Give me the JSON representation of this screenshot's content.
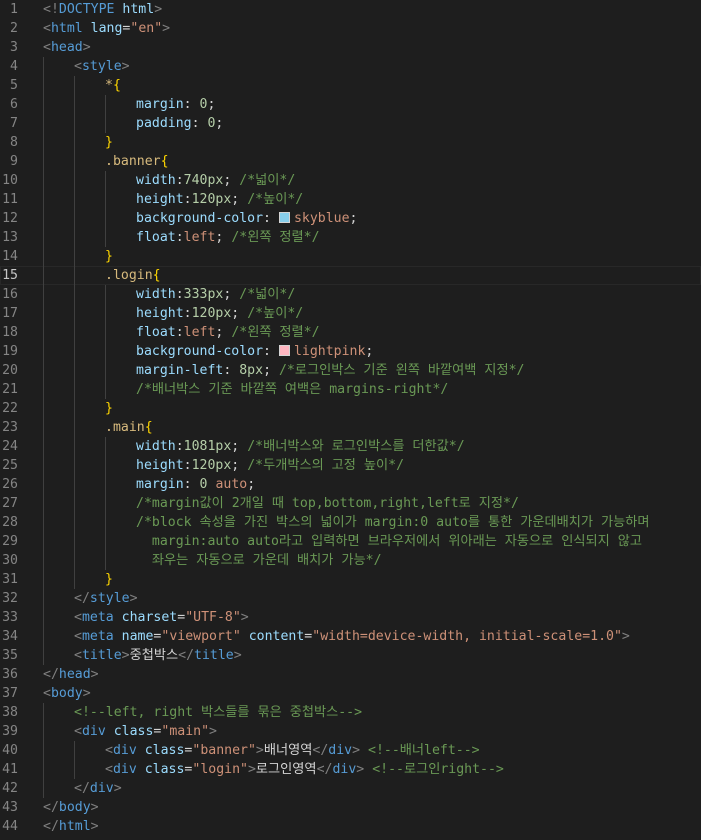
{
  "editor": {
    "current_line": 15,
    "lines": [
      {
        "n": "1",
        "indent": 0,
        "tokens": [
          {
            "t": "<!",
            "c": "punct"
          },
          {
            "t": "DOCTYPE ",
            "c": "tag"
          },
          {
            "t": "html",
            "c": "attr"
          },
          {
            "t": ">",
            "c": "punct"
          }
        ]
      },
      {
        "n": "2",
        "indent": 0,
        "tokens": [
          {
            "t": "<",
            "c": "punct"
          },
          {
            "t": "html ",
            "c": "tag"
          },
          {
            "t": "lang",
            "c": "attr"
          },
          {
            "t": "=",
            "c": "default"
          },
          {
            "t": "\"en\"",
            "c": "string"
          },
          {
            "t": ">",
            "c": "punct"
          }
        ]
      },
      {
        "n": "3",
        "indent": 0,
        "tokens": [
          {
            "t": "<",
            "c": "punct"
          },
          {
            "t": "head",
            "c": "tag"
          },
          {
            "t": ">",
            "c": "punct"
          }
        ]
      },
      {
        "n": "4",
        "indent": 1,
        "tokens": [
          {
            "t": "<",
            "c": "punct"
          },
          {
            "t": "style",
            "c": "tag"
          },
          {
            "t": ">",
            "c": "punct"
          }
        ]
      },
      {
        "n": "5",
        "indent": 2,
        "tokens": [
          {
            "t": "*",
            "c": "sel"
          },
          {
            "t": "{",
            "c": "brace"
          }
        ]
      },
      {
        "n": "6",
        "indent": 3,
        "tokens": [
          {
            "t": "margin",
            "c": "prop"
          },
          {
            "t": ": ",
            "c": "default"
          },
          {
            "t": "0",
            "c": "num"
          },
          {
            "t": ";",
            "c": "default"
          }
        ]
      },
      {
        "n": "7",
        "indent": 3,
        "tokens": [
          {
            "t": "padding",
            "c": "prop"
          },
          {
            "t": ": ",
            "c": "default"
          },
          {
            "t": "0",
            "c": "num"
          },
          {
            "t": ";",
            "c": "default"
          }
        ]
      },
      {
        "n": "8",
        "indent": 2,
        "tokens": [
          {
            "t": "}",
            "c": "brace"
          }
        ]
      },
      {
        "n": "9",
        "indent": 2,
        "tokens": [
          {
            "t": ".banner",
            "c": "sel"
          },
          {
            "t": "{",
            "c": "brace"
          }
        ]
      },
      {
        "n": "10",
        "indent": 3,
        "tokens": [
          {
            "t": "width",
            "c": "prop"
          },
          {
            "t": ":",
            "c": "default"
          },
          {
            "t": "740px",
            "c": "num"
          },
          {
            "t": "; ",
            "c": "default"
          },
          {
            "t": "/*넓이*/",
            "c": "comment"
          }
        ]
      },
      {
        "n": "11",
        "indent": 3,
        "tokens": [
          {
            "t": "height",
            "c": "prop"
          },
          {
            "t": ":",
            "c": "default"
          },
          {
            "t": "120px",
            "c": "num"
          },
          {
            "t": "; ",
            "c": "default"
          },
          {
            "t": "/*높이*/",
            "c": "comment"
          }
        ]
      },
      {
        "n": "12",
        "indent": 3,
        "tokens": [
          {
            "t": "background-color",
            "c": "prop"
          },
          {
            "t": ": ",
            "c": "default"
          },
          {
            "t": "",
            "c": "swatch",
            "color": "#87ceeb"
          },
          {
            "t": "skyblue",
            "c": "val"
          },
          {
            "t": ";",
            "c": "default"
          }
        ]
      },
      {
        "n": "13",
        "indent": 3,
        "tokens": [
          {
            "t": "float",
            "c": "prop"
          },
          {
            "t": ":",
            "c": "default"
          },
          {
            "t": "left",
            "c": "val"
          },
          {
            "t": "; ",
            "c": "default"
          },
          {
            "t": "/*왼쪽 정렬*/",
            "c": "comment"
          }
        ]
      },
      {
        "n": "14",
        "indent": 2,
        "tokens": [
          {
            "t": "}",
            "c": "brace"
          }
        ]
      },
      {
        "n": "15",
        "indent": 2,
        "tokens": [
          {
            "t": ".login",
            "c": "sel"
          },
          {
            "t": "{",
            "c": "brace"
          }
        ]
      },
      {
        "n": "16",
        "indent": 3,
        "tokens": [
          {
            "t": "width",
            "c": "prop"
          },
          {
            "t": ":",
            "c": "default"
          },
          {
            "t": "333px",
            "c": "num"
          },
          {
            "t": "; ",
            "c": "default"
          },
          {
            "t": "/*넓이*/",
            "c": "comment"
          }
        ]
      },
      {
        "n": "17",
        "indent": 3,
        "tokens": [
          {
            "t": "height",
            "c": "prop"
          },
          {
            "t": ":",
            "c": "default"
          },
          {
            "t": "120px",
            "c": "num"
          },
          {
            "t": "; ",
            "c": "default"
          },
          {
            "t": "/*높이*/",
            "c": "comment"
          }
        ]
      },
      {
        "n": "18",
        "indent": 3,
        "tokens": [
          {
            "t": "float",
            "c": "prop"
          },
          {
            "t": ":",
            "c": "default"
          },
          {
            "t": "left",
            "c": "val"
          },
          {
            "t": "; ",
            "c": "default"
          },
          {
            "t": "/*왼쪽 정렬*/",
            "c": "comment"
          }
        ]
      },
      {
        "n": "19",
        "indent": 3,
        "tokens": [
          {
            "t": "background-color",
            "c": "prop"
          },
          {
            "t": ": ",
            "c": "default"
          },
          {
            "t": "",
            "c": "swatch",
            "color": "#ffb6c1"
          },
          {
            "t": "lightpink",
            "c": "val"
          },
          {
            "t": ";",
            "c": "default"
          }
        ]
      },
      {
        "n": "20",
        "indent": 3,
        "tokens": [
          {
            "t": "margin-left",
            "c": "prop"
          },
          {
            "t": ": ",
            "c": "default"
          },
          {
            "t": "8px",
            "c": "num"
          },
          {
            "t": "; ",
            "c": "default"
          },
          {
            "t": "/*로그인박스 기준 왼쪽 바깥여백 지정*/",
            "c": "comment"
          }
        ]
      },
      {
        "n": "21",
        "indent": 3,
        "tokens": [
          {
            "t": "/*배너박스 기준 바깥쪽 여백은 margins-right*/",
            "c": "comment"
          }
        ]
      },
      {
        "n": "22",
        "indent": 2,
        "tokens": [
          {
            "t": "}",
            "c": "brace"
          }
        ]
      },
      {
        "n": "23",
        "indent": 2,
        "tokens": [
          {
            "t": ".main",
            "c": "sel"
          },
          {
            "t": "{",
            "c": "brace"
          }
        ]
      },
      {
        "n": "24",
        "indent": 3,
        "tokens": [
          {
            "t": "width",
            "c": "prop"
          },
          {
            "t": ":",
            "c": "default"
          },
          {
            "t": "1081px",
            "c": "num"
          },
          {
            "t": "; ",
            "c": "default"
          },
          {
            "t": "/*배너박스와 로그인박스를 더한값*/",
            "c": "comment"
          }
        ]
      },
      {
        "n": "25",
        "indent": 3,
        "tokens": [
          {
            "t": "height",
            "c": "prop"
          },
          {
            "t": ":",
            "c": "default"
          },
          {
            "t": "120px",
            "c": "num"
          },
          {
            "t": "; ",
            "c": "default"
          },
          {
            "t": "/*두개박스의 고정 높이*/",
            "c": "comment"
          }
        ]
      },
      {
        "n": "26",
        "indent": 3,
        "tokens": [
          {
            "t": "margin",
            "c": "prop"
          },
          {
            "t": ": ",
            "c": "default"
          },
          {
            "t": "0",
            "c": "num"
          },
          {
            "t": " ",
            "c": "default"
          },
          {
            "t": "auto",
            "c": "val"
          },
          {
            "t": ";",
            "c": "default"
          }
        ]
      },
      {
        "n": "27",
        "indent": 3,
        "tokens": [
          {
            "t": "/*margin값이 2개일 때 top,bottom,right,left로 지정*/",
            "c": "comment"
          }
        ]
      },
      {
        "n": "28",
        "indent": 3,
        "tokens": [
          {
            "t": "/*block 속성을 가진 박스의 넓이가 margin:0 auto를 통한 가운데배치가 가능하며",
            "c": "comment"
          }
        ]
      },
      {
        "n": "29",
        "indent": 3,
        "tokens": [
          {
            "t": "  margin:auto auto라고 입력하면 브라우저에서 위아래는 자동으로 인식되지 않고",
            "c": "comment"
          }
        ]
      },
      {
        "n": "30",
        "indent": 3,
        "tokens": [
          {
            "t": "  좌우는 자동으로 가운데 배치가 가능*/",
            "c": "comment"
          }
        ]
      },
      {
        "n": "31",
        "indent": 2,
        "tokens": [
          {
            "t": "}",
            "c": "brace"
          }
        ]
      },
      {
        "n": "32",
        "indent": 1,
        "tokens": [
          {
            "t": "</",
            "c": "punct"
          },
          {
            "t": "style",
            "c": "tag"
          },
          {
            "t": ">",
            "c": "punct"
          }
        ]
      },
      {
        "n": "33",
        "indent": 1,
        "tokens": [
          {
            "t": "<",
            "c": "punct"
          },
          {
            "t": "meta ",
            "c": "tag"
          },
          {
            "t": "charset",
            "c": "attr"
          },
          {
            "t": "=",
            "c": "default"
          },
          {
            "t": "\"UTF-8\"",
            "c": "string"
          },
          {
            "t": ">",
            "c": "punct"
          }
        ]
      },
      {
        "n": "34",
        "indent": 1,
        "tokens": [
          {
            "t": "<",
            "c": "punct"
          },
          {
            "t": "meta ",
            "c": "tag"
          },
          {
            "t": "name",
            "c": "attr"
          },
          {
            "t": "=",
            "c": "default"
          },
          {
            "t": "\"viewport\" ",
            "c": "string"
          },
          {
            "t": "content",
            "c": "attr"
          },
          {
            "t": "=",
            "c": "default"
          },
          {
            "t": "\"width=device-width, initial-scale=1.0\"",
            "c": "string"
          },
          {
            "t": ">",
            "c": "punct"
          }
        ]
      },
      {
        "n": "35",
        "indent": 1,
        "tokens": [
          {
            "t": "<",
            "c": "punct"
          },
          {
            "t": "title",
            "c": "tag"
          },
          {
            "t": ">",
            "c": "punct"
          },
          {
            "t": "중첩박스",
            "c": "default"
          },
          {
            "t": "</",
            "c": "punct"
          },
          {
            "t": "title",
            "c": "tag"
          },
          {
            "t": ">",
            "c": "punct"
          }
        ]
      },
      {
        "n": "36",
        "indent": 0,
        "tokens": [
          {
            "t": "</",
            "c": "punct"
          },
          {
            "t": "head",
            "c": "tag"
          },
          {
            "t": ">",
            "c": "punct"
          }
        ]
      },
      {
        "n": "37",
        "indent": 0,
        "tokens": [
          {
            "t": "<",
            "c": "punct"
          },
          {
            "t": "body",
            "c": "tag"
          },
          {
            "t": ">",
            "c": "punct"
          }
        ]
      },
      {
        "n": "38",
        "indent": 1,
        "tokens": [
          {
            "t": "<!--left, right 박스들를 묶은 중첩박스-->",
            "c": "comment"
          }
        ]
      },
      {
        "n": "39",
        "indent": 1,
        "tokens": [
          {
            "t": "<",
            "c": "punct"
          },
          {
            "t": "div ",
            "c": "tag"
          },
          {
            "t": "class",
            "c": "attr"
          },
          {
            "t": "=",
            "c": "default"
          },
          {
            "t": "\"main\"",
            "c": "string"
          },
          {
            "t": ">",
            "c": "punct"
          }
        ]
      },
      {
        "n": "40",
        "indent": 2,
        "tokens": [
          {
            "t": "<",
            "c": "punct"
          },
          {
            "t": "div ",
            "c": "tag"
          },
          {
            "t": "class",
            "c": "attr"
          },
          {
            "t": "=",
            "c": "default"
          },
          {
            "t": "\"banner\"",
            "c": "string"
          },
          {
            "t": ">",
            "c": "punct"
          },
          {
            "t": "배너영역",
            "c": "default"
          },
          {
            "t": "</",
            "c": "punct"
          },
          {
            "t": "div",
            "c": "tag"
          },
          {
            "t": ">",
            "c": "punct"
          },
          {
            "t": " ",
            "c": "default"
          },
          {
            "t": "<!--배너left-->",
            "c": "comment"
          }
        ]
      },
      {
        "n": "41",
        "indent": 2,
        "tokens": [
          {
            "t": "<",
            "c": "punct"
          },
          {
            "t": "div ",
            "c": "tag"
          },
          {
            "t": "class",
            "c": "attr"
          },
          {
            "t": "=",
            "c": "default"
          },
          {
            "t": "\"login\"",
            "c": "string"
          },
          {
            "t": ">",
            "c": "punct"
          },
          {
            "t": "로그인영역",
            "c": "default"
          },
          {
            "t": "</",
            "c": "punct"
          },
          {
            "t": "div",
            "c": "tag"
          },
          {
            "t": ">",
            "c": "punct"
          },
          {
            "t": " ",
            "c": "default"
          },
          {
            "t": "<!--로그인right-->",
            "c": "comment"
          }
        ]
      },
      {
        "n": "42",
        "indent": 1,
        "tokens": [
          {
            "t": "</",
            "c": "punct"
          },
          {
            "t": "div",
            "c": "tag"
          },
          {
            "t": ">",
            "c": "punct"
          }
        ]
      },
      {
        "n": "43",
        "indent": 0,
        "tokens": [
          {
            "t": "</",
            "c": "punct"
          },
          {
            "t": "body",
            "c": "tag"
          },
          {
            "t": ">",
            "c": "punct"
          }
        ]
      },
      {
        "n": "44",
        "indent": 0,
        "tokens": [
          {
            "t": "</",
            "c": "punct"
          },
          {
            "t": "html",
            "c": "tag"
          },
          {
            "t": ">",
            "c": "punct"
          }
        ]
      }
    ]
  }
}
